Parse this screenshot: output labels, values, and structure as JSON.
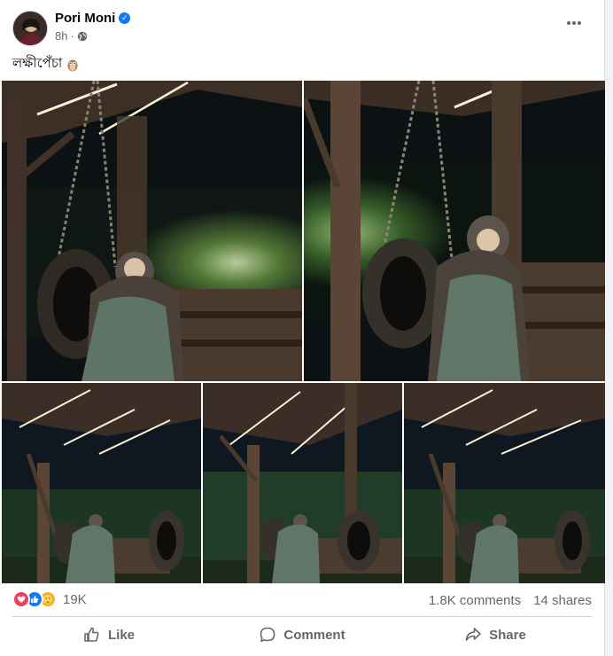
{
  "post": {
    "author": "Pori Moni",
    "time": "8h",
    "separator": "·",
    "caption": "লক্ষীপেঁচা"
  },
  "reactions": {
    "count": "19K",
    "types": [
      "love-icon",
      "like-icon",
      "care-icon"
    ]
  },
  "stats": {
    "comments": "1.8K comments",
    "shares": "14 shares"
  },
  "actions": {
    "like": "Like",
    "comment": "Comment",
    "share": "Share"
  },
  "colors": {
    "brand_blue": "#1877f2",
    "love_red": "#f33e58",
    "care_yellow": "#f7b125",
    "secondary_text": "#65676b"
  },
  "photos": [
    {
      "description_icon": "photo-swing-1"
    },
    {
      "description_icon": "photo-swing-2"
    },
    {
      "description_icon": "photo-swing-3"
    },
    {
      "description_icon": "photo-swing-4"
    },
    {
      "description_icon": "photo-swing-5"
    }
  ]
}
